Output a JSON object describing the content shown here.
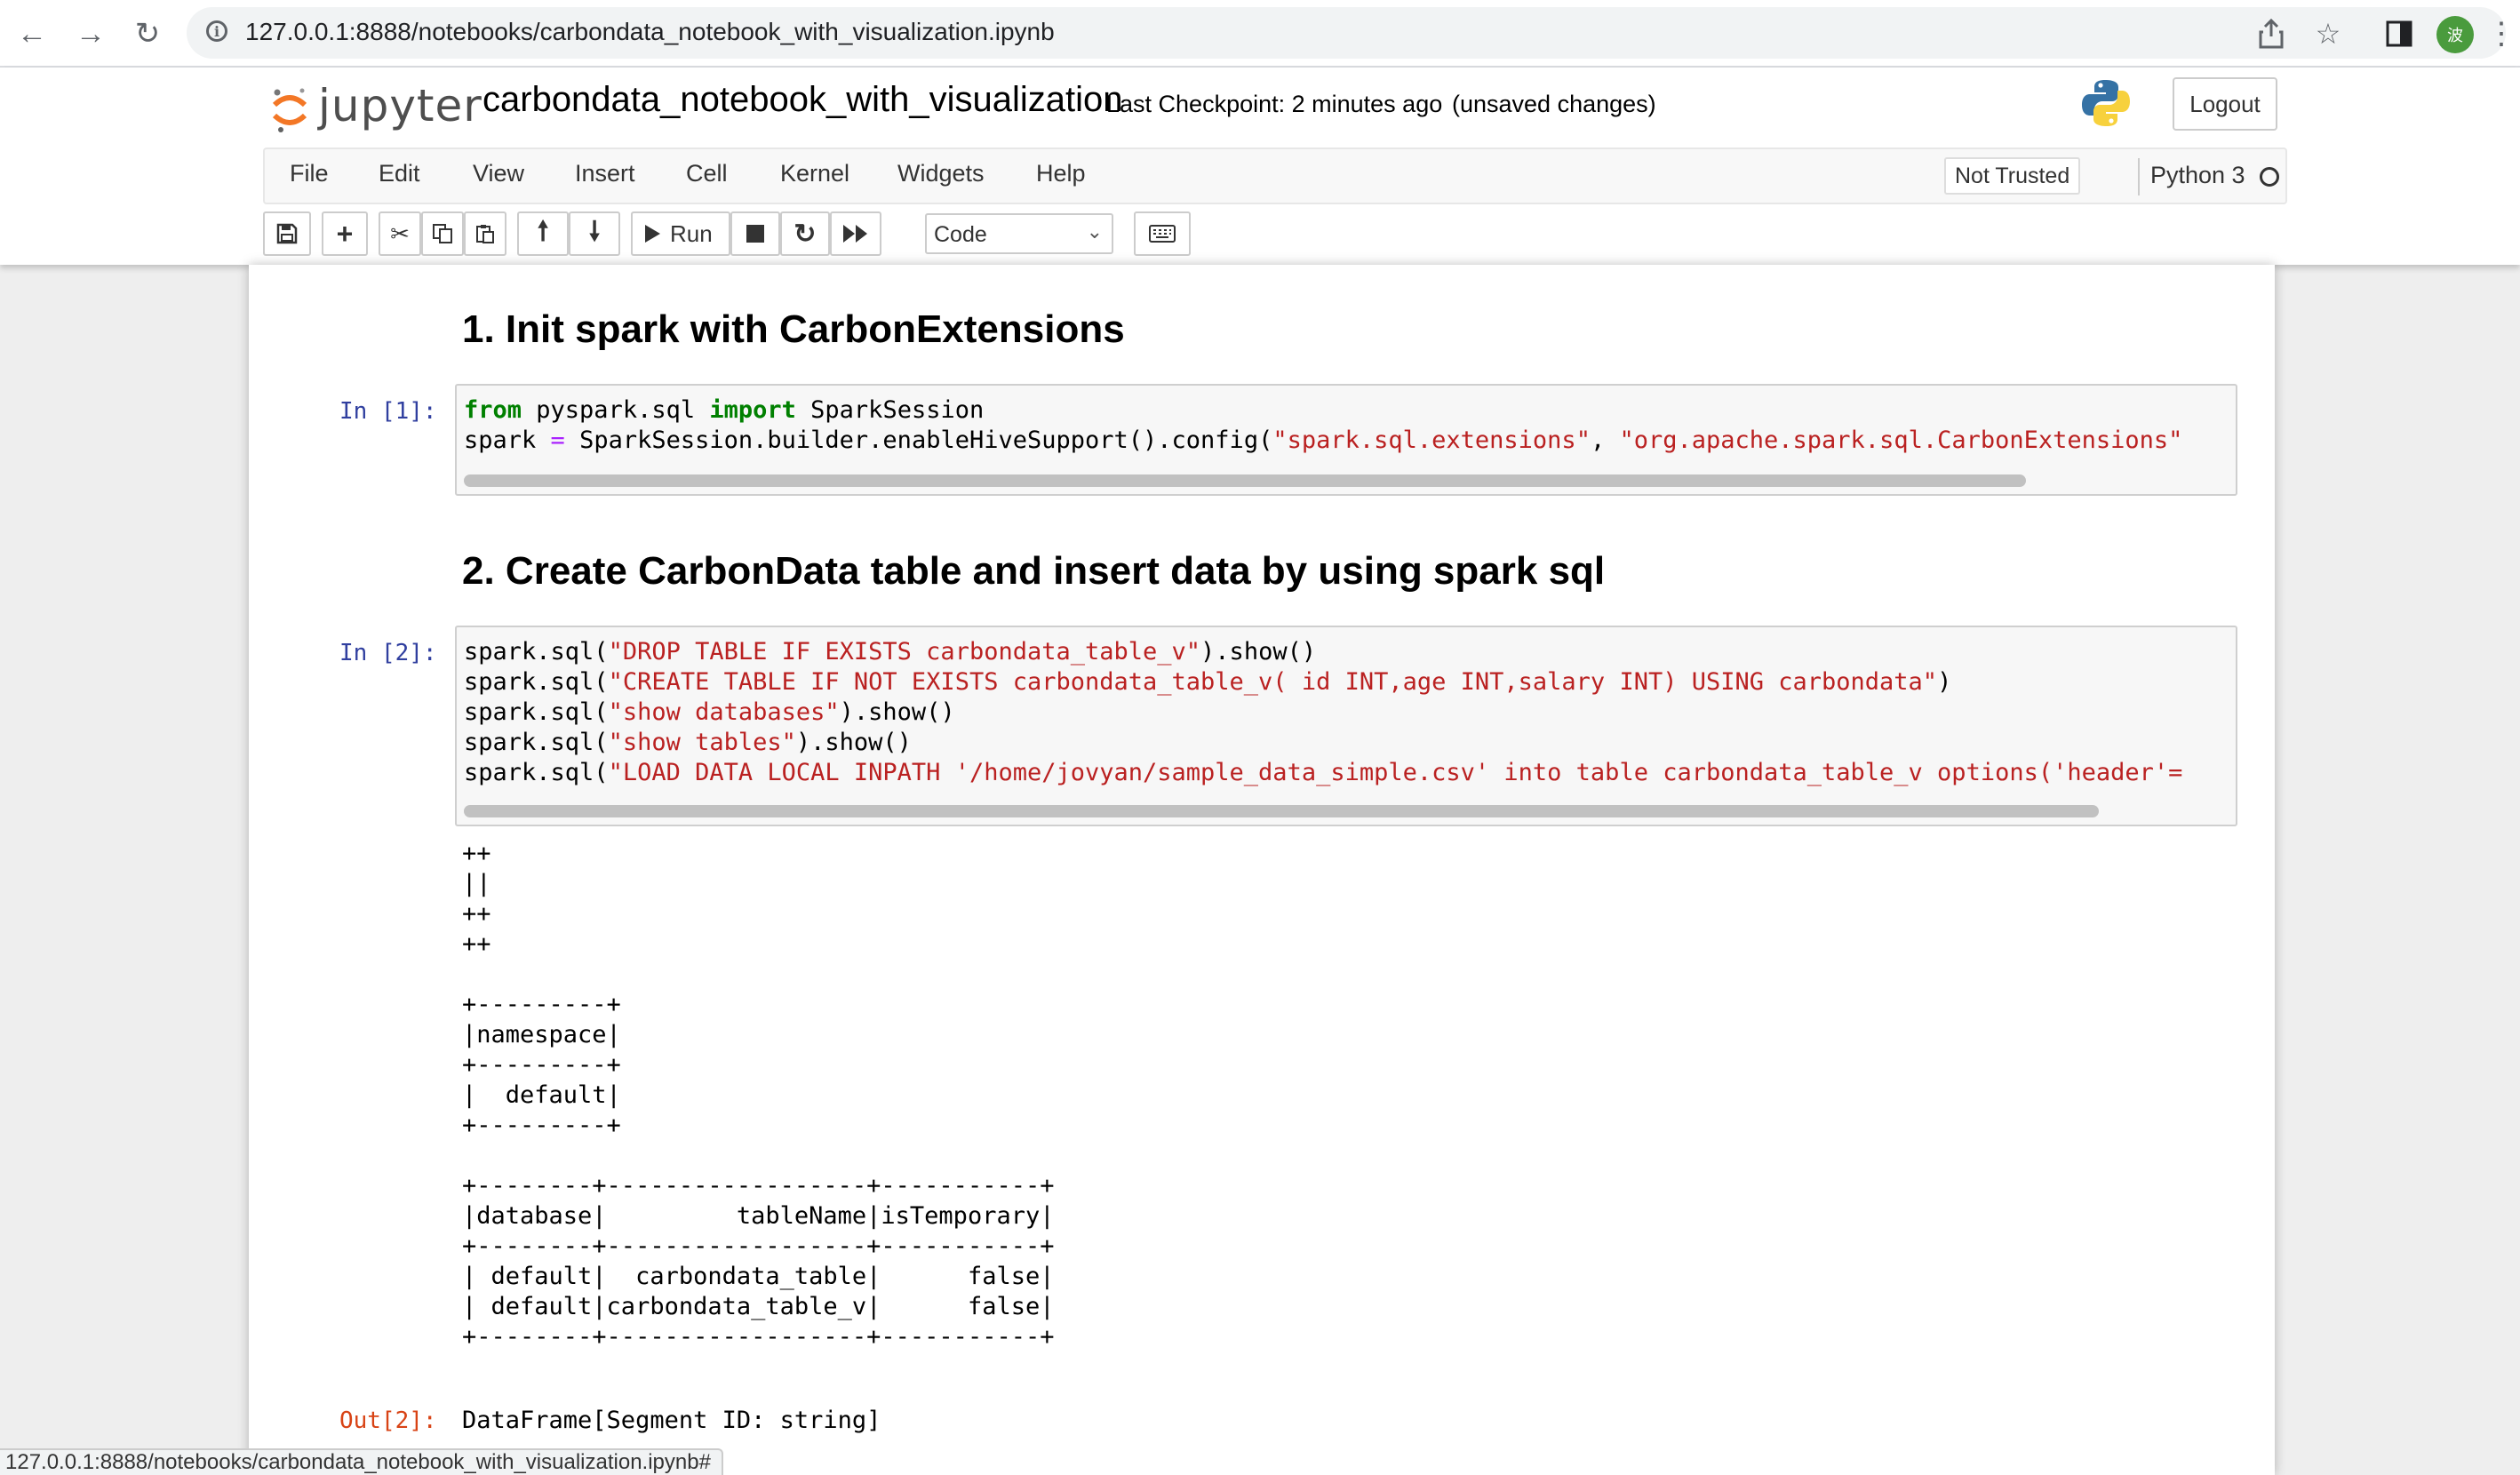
{
  "browser": {
    "url": "127.0.0.1:8888/notebooks/carbondata_notebook_with_visualization.ipynb",
    "profile_initial": "波",
    "status_url": "127.0.0.1:8888/notebooks/carbondata_notebook_with_visualization.ipynb#"
  },
  "header": {
    "logo_text": "jupyter",
    "notebook_title": "carbondata_notebook_with_visualization",
    "checkpoint": "Last Checkpoint: 2 minutes ago",
    "unsaved": "(unsaved changes)",
    "logout_label": "Logout"
  },
  "menu": {
    "items": [
      "File",
      "Edit",
      "View",
      "Insert",
      "Cell",
      "Kernel",
      "Widgets",
      "Help"
    ],
    "trust": "Not Trusted",
    "kernel": "Python 3"
  },
  "toolbar": {
    "run_label": "Run",
    "cell_type": "Code"
  },
  "cells": {
    "h1": "1. Init spark with CarbonExtensions",
    "c1": {
      "prompt": "In [1]:",
      "line1_kw1": "from",
      "line1_mid": " pyspark.sql ",
      "line1_kw2": "import",
      "line1_end": " SparkSession",
      "line2_a": "spark ",
      "line2_op": "=",
      "line2_b": " SparkSession.builder.enableHiveSupport().config(",
      "line2_s1": "\"spark.sql.extensions\"",
      "line2_c": ", ",
      "line2_s2": "\"org.apache.spark.sql.CarbonExtensions\""
    },
    "h2": "2. Create CarbonData table and insert data by using spark sql",
    "c2": {
      "prompt": "In [2]:",
      "pre": "spark.sql(",
      "l1_str": "\"DROP TABLE IF EXISTS carbondata_table_v\"",
      "l1_end": ").show()",
      "l2_str": "\"CREATE TABLE IF NOT EXISTS carbondata_table_v( id INT,age INT,salary INT) USING carbondata\"",
      "l2_end": ")",
      "l3_str": "\"show databases\"",
      "l3_end": ").show()",
      "l4_str": "\"show tables\"",
      "l4_end": ").show()",
      "l5_str": "\"LOAD DATA LOCAL INPATH '/home/jovyan/sample_data_simple.csv' into table carbondata_table_v options('header'="
    },
    "output_stdout": "++\n||\n++\n++\n\n+---------+\n|namespace|\n+---------+\n|  default|\n+---------+\n\n+--------+------------------+-----------+\n|database|         tableName|isTemporary|\n+--------+------------------+-----------+\n| default|  carbondata_table|      false|\n| default|carbondata_table_v|      false|\n+--------+------------------+-----------+",
    "out_prompt": "Out[2]:",
    "out_value": "DataFrame[Segment ID: string]"
  }
}
